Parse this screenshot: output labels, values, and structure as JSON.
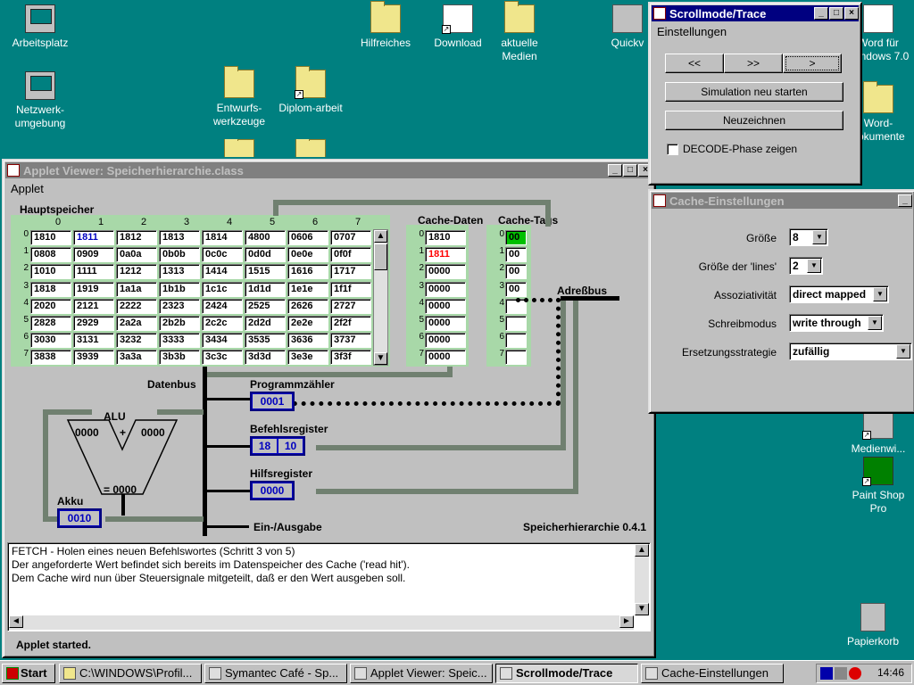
{
  "desktop": {
    "icons": [
      {
        "name": "arbeitsplatz-icon",
        "label": "Arbeitsplatz"
      },
      {
        "name": "netzwerkumgebung-icon",
        "label": "Netzwerk-umgebung"
      },
      {
        "name": "hilfreiches-icon",
        "label": "Hilfreiches"
      },
      {
        "name": "download-icon",
        "label": "Download"
      },
      {
        "name": "aktuelle-medien-icon",
        "label": "aktuelle Medien"
      },
      {
        "name": "quickview-icon",
        "label": "Quickv"
      },
      {
        "name": "entwurfswerkzeuge-icon",
        "label": "Entwurfs-werkzeuge"
      },
      {
        "name": "diplomarbeit-icon",
        "label": "Diplom-arbeit"
      },
      {
        "name": "word-icon",
        "label": "Word für Windows 7.0"
      },
      {
        "name": "word-dokumente-icon",
        "label": "Word-dokumente"
      },
      {
        "name": "medienwiedergabe-icon",
        "label": "Medienwi..."
      },
      {
        "name": "paintshop-icon",
        "label": "Paint Shop Pro"
      },
      {
        "name": "papierkorb-icon",
        "label": "Papierkorb"
      }
    ]
  },
  "applet": {
    "title": "Applet Viewer: Speicherhierarchie.class",
    "menu": "Applet",
    "hauptspeicher_label": "Hauptspeicher",
    "columns": [
      "0",
      "1",
      "2",
      "3",
      "4",
      "5",
      "6",
      "7"
    ],
    "rows": [
      "0",
      "1",
      "2",
      "3",
      "4",
      "5",
      "6",
      "7"
    ],
    "memory": [
      [
        "1810",
        "1811",
        "1812",
        "1813",
        "1814",
        "4800",
        "0606",
        "0707"
      ],
      [
        "0808",
        "0909",
        "0a0a",
        "0b0b",
        "0c0c",
        "0d0d",
        "0e0e",
        "0f0f"
      ],
      [
        "1010",
        "1111",
        "1212",
        "1313",
        "1414",
        "1515",
        "1616",
        "1717"
      ],
      [
        "1818",
        "1919",
        "1a1a",
        "1b1b",
        "1c1c",
        "1d1d",
        "1e1e",
        "1f1f"
      ],
      [
        "2020",
        "2121",
        "2222",
        "2323",
        "2424",
        "2525",
        "2626",
        "2727"
      ],
      [
        "2828",
        "2929",
        "2a2a",
        "2b2b",
        "2c2c",
        "2d2d",
        "2e2e",
        "2f2f"
      ],
      [
        "3030",
        "3131",
        "3232",
        "3333",
        "3434",
        "3535",
        "3636",
        "3737"
      ],
      [
        "3838",
        "3939",
        "3a3a",
        "3b3b",
        "3c3c",
        "3d3d",
        "3e3e",
        "3f3f"
      ]
    ],
    "highlight_color": "#0000c0",
    "cache_daten_label": "Cache-Daten",
    "cache_daten": [
      "1810",
      "1811",
      "0000",
      "0000",
      "0000",
      "0000",
      "0000",
      "0000"
    ],
    "cache_hit_color": "#ff0000",
    "cache_tags_label": "Cache-Tags",
    "cache_tags": [
      "00",
      "00",
      "00",
      "00",
      "",
      "",
      "",
      ""
    ],
    "tag_active_color": "#00c000",
    "adressbus_label": "Adreßbus",
    "datenbus_label": "Datenbus",
    "pc_label": "Programmzähler",
    "pc_value": "0001",
    "befehlsregister_label": "Befehlsregister",
    "befehlsregister": [
      "18",
      "10"
    ],
    "hilfsregister_label": "Hilfsregister",
    "hilfsregister_value": "0000",
    "alu_label": "ALU",
    "alu_left": "0000",
    "alu_op": "+",
    "alu_right": "0000",
    "alu_result": "= 0000",
    "akku_label": "Akku",
    "akku_value": "0010",
    "io_label": "Ein-/Ausgabe",
    "version": "Speicherhierarchie 0.4.1",
    "log_lines": [
      "FETCH - Holen eines neuen Befehlswortes (Schritt 3 von 5)",
      "Der angeforderte Wert befindet sich bereits im Datenspeicher des Cache ('read hit').",
      "Dem Cache wird nun über Steuersignale mitgeteilt, daß er den Wert ausgeben soll."
    ],
    "status": "Applet started."
  },
  "scroll": {
    "title": "Scrollmode/Trace",
    "menu": "Einstellungen",
    "btn_back": "<<",
    "btn_fwd": ">>",
    "btn_step": ">",
    "btn_restart": "Simulation neu starten",
    "btn_redraw": "Neuzeichnen",
    "decode_label": "DECODE-Phase zeigen"
  },
  "cache": {
    "title": "Cache-Einstellungen",
    "groesse_label": "Größe",
    "groesse_value": "8",
    "lines_label": "Größe der 'lines'",
    "lines_value": "2",
    "assoz_label": "Assoziativität",
    "assoz_value": "direct mapped",
    "schreib_label": "Schreibmodus",
    "schreib_value": "write through",
    "ersetz_label": "Ersetzungsstrategie",
    "ersetz_value": "zufällig"
  },
  "taskbar": {
    "start": "Start",
    "tasks": [
      "C:\\WINDOWS\\Profil...",
      "Symantec Café - Sp...",
      "Applet Viewer: Speic...",
      "Scrollmode/Trace",
      "Cache-Einstellungen"
    ],
    "clock": "14:46"
  }
}
